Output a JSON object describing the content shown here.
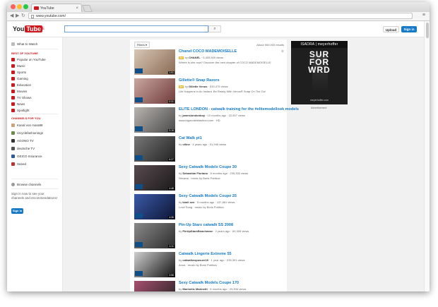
{
  "browser": {
    "tab_title": "YouTube",
    "tab_close": "×",
    "url": "www.youtube.com/",
    "nav_back": "◀",
    "nav_forward": "▶",
    "nav_reload": "↻",
    "menu": "≡"
  },
  "masthead": {
    "logo_you": "You",
    "logo_tube": "Tube",
    "region": "DE",
    "search_icon": "⌕",
    "upload_label": "Upload",
    "signin_label": "Sign in"
  },
  "guide": {
    "what_to_watch": "What to Watch",
    "best_of_header": "BEST OF YOUTUBE",
    "best_of": [
      "Popular on YouTube",
      "Music",
      "Sports",
      "Gaming",
      "Education",
      "Movies",
      "TV Shows",
      "News",
      "Spotlight"
    ],
    "channels_header": "CHANNELS FOR YOU",
    "channels": [
      "Kanal von mara98",
      "recyclefashionings",
      "AGONO TV",
      "deutsche TV",
      "GEICO Insurance",
      "Seeed"
    ],
    "browse_channels": "Browse channels",
    "signin_prompt": "Sign in now to see your channels and recommendations!",
    "signin_button": "Sign in"
  },
  "results": {
    "filters_label": "Filters ▾",
    "about_text": "About 900,000 results",
    "items": [
      {
        "title": "Chanel COCO MADEMOISELLE",
        "ad": "Ad",
        "channel": "CHANEL",
        "meta": " · 5,405,509 views",
        "desc": "Where is she now? Discover the next chapter of COCO MADEMOISELLE",
        "duration": "1:01",
        "colors": [
          "#d8c7b5",
          "#8a6a55"
        ]
      },
      {
        "title": "Gillette® Snap Razors",
        "ad": "Ad",
        "channel": "Gillette Venus",
        "meta": " · 530,475 views",
        "desc": "Life Happens in An Instant. Be Ready With Venus® Snap On The Go!",
        "duration": "0:31",
        "colors": [
          "#caa6a0",
          "#6e3b3b"
        ]
      },
      {
        "title": "ELITE LONDON - catwalk training for the #elitemodellook models",
        "ad": "",
        "channel": "jameslondonboy",
        "meta": " · 10 months ago · 22,507 views",
        "desc": "www.bigmodelsfashion.com · HD",
        "duration": "3:15",
        "colors": [
          "#b8b4b0",
          "#4a4a4a"
        ]
      },
      {
        "title": "Cat Walk pt1",
        "ad": "",
        "channel": "ctline",
        "meta": " · 4 years ago · 91,946 views",
        "desc": "",
        "duration": "6:27",
        "colors": [
          "#777",
          "#222"
        ]
      },
      {
        "title": "Sexy Catwalk Models Coupe 30",
        "ad": "",
        "channel": "Sebastian Floriano",
        "meta": " · 8 months ago · 235,350 views",
        "desc": "Nirvana · music by Boris Pobikov",
        "duration": "4:48",
        "colors": [
          "#5a4a50",
          "#1a1a1a"
        ]
      },
      {
        "title": "Sexy Catwalk Models Coupe 25",
        "ad": "",
        "channel": "kimli sen",
        "meta": " · 5 months ago · 137,861 views",
        "desc": "Love Song · music by Boris Pobikov",
        "duration": "4:36",
        "colors": [
          "#3b5aa8",
          "#0c1433"
        ]
      },
      {
        "title": "Pin-Up Stars catwalk SS 2008",
        "ad": "",
        "channel": "PinUpStarsBeachwear",
        "meta": " · 2 years ago · 69,305 views",
        "desc": "",
        "duration": "4:11",
        "colors": [
          "#8a8a8a",
          "#2b2b2b"
        ]
      },
      {
        "title": "Catwalk Lingerie Extreme 55",
        "ad": "",
        "channel": "catwalkexposure19",
        "meta": " · 1 year ago · 335,301 views",
        "desc": "Anna · music by Boris Pobikov",
        "duration": "3:58",
        "colors": [
          "#d0d0d0",
          "#111"
        ]
      },
      {
        "title": "Sexy Catwalk Models Coupe 170",
        "ad": "",
        "channel": "Marinetic Marinetti",
        "meta": " · 5 months ago · 25,534 views",
        "desc": "",
        "duration": "3:40",
        "colors": [
          "#a85070",
          "#1f1f1f"
        ]
      }
    ]
  },
  "ad": {
    "brand": "ISADRA | meyerhoffer",
    "line1": "SUR",
    "line2": "FOR",
    "line3": "WRD",
    "tagline": "meyerhoffer.com",
    "label": "Advertisement"
  }
}
